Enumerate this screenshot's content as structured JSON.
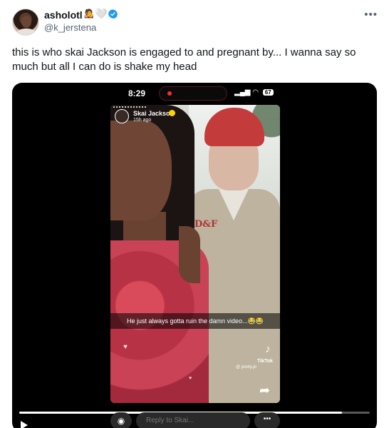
{
  "author": {
    "display_name": "asholotl",
    "handle": "@k_jerstena",
    "badge_emoji": "🧑‍🎤",
    "heart_glyph": "🤍",
    "verified_color": "#1d9bf0"
  },
  "tweet": {
    "text": "this is who skai Jackson is engaged to and pregnant by... I wanna say so much but all I can do is shake my head"
  },
  "video": {
    "status_time": "8:29",
    "battery": "67",
    "story": {
      "name": "Skai Jackson",
      "time_ago": "15h ago",
      "caption": "He just always gotta ruin the damn video...😂😂",
      "tiktok_brand": "TikTok",
      "tiktok_user": "@ pretty.pl",
      "shirt_logo": "D&F"
    },
    "reply_placeholder": "Reply to Skai...",
    "progress": 0.92,
    "accent_red": "#ff2b2b"
  },
  "icons": {
    "more": "more-horizontal-icon",
    "verified": "verified-badge-icon",
    "camera": "camera-icon",
    "share": "share-arrow-icon",
    "tiktok": "tiktok-logo-icon",
    "play": "play-icon"
  }
}
